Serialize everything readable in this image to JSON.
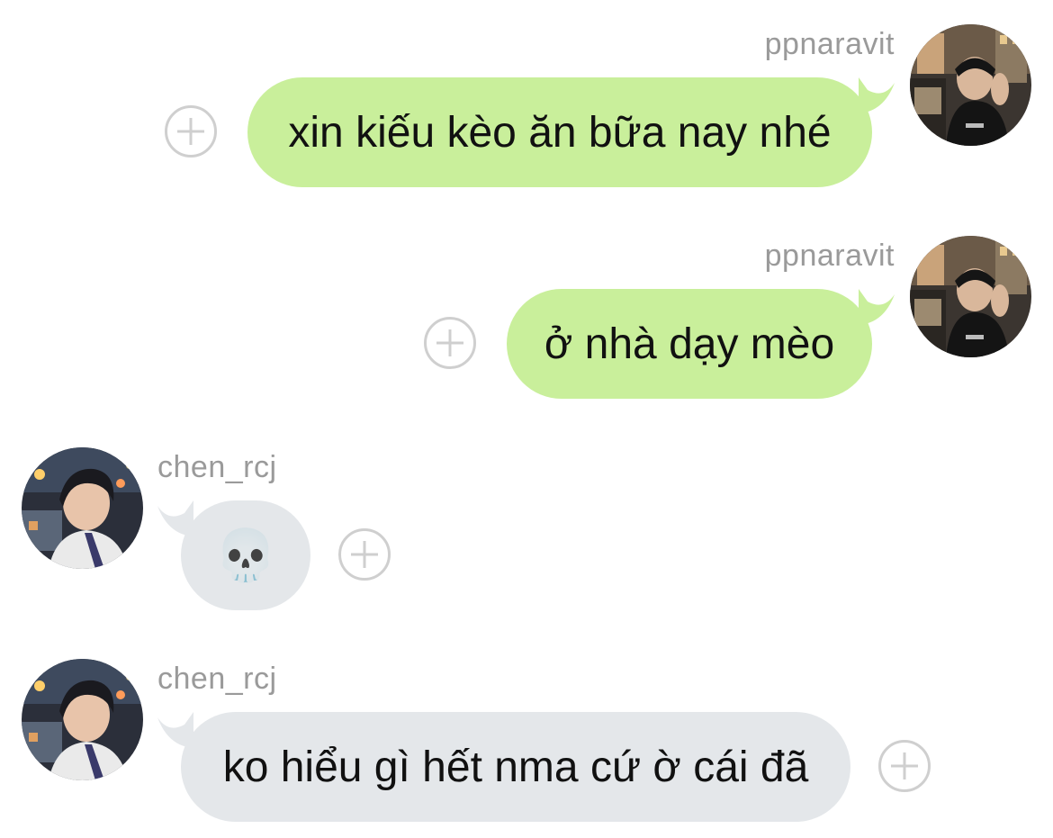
{
  "messages": [
    {
      "sender": "ppnaravit",
      "side": "right",
      "text": "xin kiếu kèo ăn bữa nay nhé",
      "avatar": "avatar-ppnaravit"
    },
    {
      "sender": "ppnaravit",
      "side": "right",
      "text": "ở nhà dạy mèo",
      "avatar": "avatar-ppnaravit"
    },
    {
      "sender": "chen_rcj",
      "side": "left",
      "text": "💀",
      "avatar": "avatar-chen_rcj"
    },
    {
      "sender": "chen_rcj",
      "side": "left",
      "text": "ko hiểu gì hết nma cứ ờ cái đã",
      "avatar": "avatar-chen_rcj"
    }
  ],
  "icons": {
    "react": "add-reaction-icon"
  },
  "colors": {
    "outgoing_bubble": "#c9ef9b",
    "incoming_bubble": "#e4e7ea",
    "sender_name": "#9a9a9a",
    "react_icon": "#cfcfcf"
  }
}
